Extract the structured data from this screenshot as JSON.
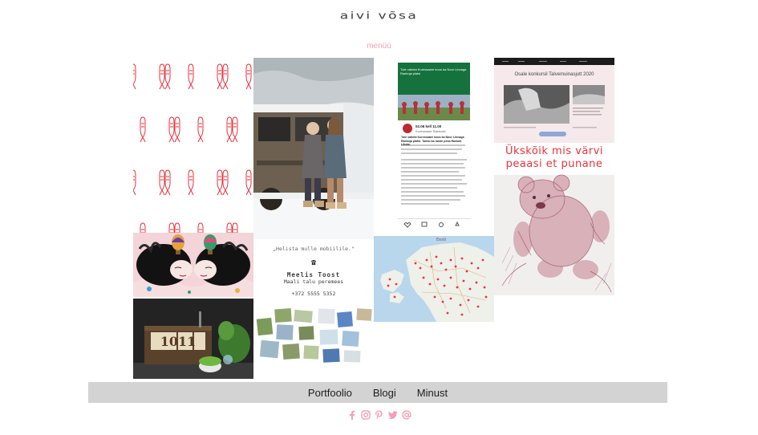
{
  "site": {
    "logo_text": "aivi võsa",
    "menu_label": "menüü"
  },
  "gallery": {
    "phone_post": {
      "app_header": "Tule vaheta Kuressaare koos ka Noor Linnaga Raekoja platsi",
      "event_date": "02.06 kell 11.00",
      "event_place": "Kuressaare Raekoda",
      "event_title": "Tule vaheta Kuressaare koos ka Noor Linnaga Raekoja platsi. Tantsi ka rande pesa Raekoti Lõuka."
    },
    "card": {
      "quote": "„Helista mulle mobiilile.\"",
      "phone_glyph": "☎",
      "name": "Meelis Toost",
      "subtitle": "Maali talu peremees",
      "phone": "+372 5555 5352"
    },
    "contest": {
      "title": "Osale konkursil Talvemuinasjutt 2020"
    },
    "bear_art": {
      "line1": "Ükskõik mis värvi",
      "line2": "peaasi et punane"
    },
    "map": {
      "country_label": "Eesti"
    },
    "rustic_sign": "1011"
  },
  "footer": {
    "nav": [
      {
        "label": "Portfoolio"
      },
      {
        "label": "Blogi"
      },
      {
        "label": "Minust"
      }
    ],
    "social_icons": [
      "facebook-icon",
      "instagram-icon",
      "pinterest-icon",
      "twitter-icon",
      "email-icon"
    ],
    "accent_color": "#f2a0b8"
  }
}
